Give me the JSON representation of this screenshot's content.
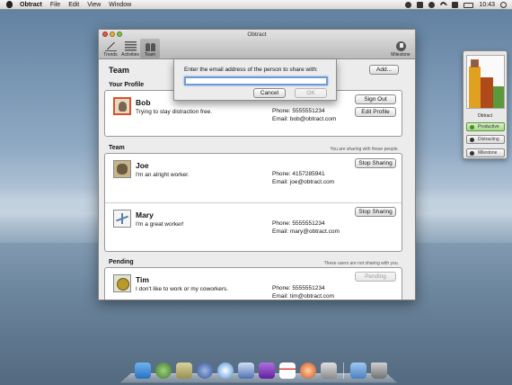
{
  "menubar": {
    "app_name": "Obtract",
    "menus": [
      "File",
      "Edit",
      "View",
      "Window"
    ],
    "clock": "10:43"
  },
  "window": {
    "title": "Obtract",
    "toolbar": {
      "trends": "Trends",
      "activities": "Activities",
      "team": "Team",
      "milestone": "Milestone"
    }
  },
  "team_page": {
    "title": "Team",
    "add_button": "Add...",
    "profile_section": "Your Profile",
    "team_section": "Team",
    "team_note": "You are sharing with these people.",
    "pending_section": "Pending",
    "pending_note": "These users are not sharing with you."
  },
  "profile": {
    "name": "Bob",
    "status": "Trying to stay distraction free.",
    "phone": "Phone: 5555551234",
    "email": "Email: bob@obtract.com",
    "sign_out": "Sign Out",
    "edit_profile": "Edit Profile"
  },
  "team_members": [
    {
      "name": "Joe",
      "status": "I'm an alright worker.",
      "phone": "Phone: 4157285941",
      "email": "Email: joe@obtract.com",
      "action": "Stop Sharing"
    },
    {
      "name": "Mary",
      "status": "I'm a great worker!",
      "phone": "Phone: 5555551234",
      "email": "Email: mary@obtract.com",
      "action": "Stop Sharing"
    }
  ],
  "pending": [
    {
      "name": "Tim",
      "status": "I don't like to work or my coworkers.",
      "phone": "Phone: 5555551234",
      "email": "Email: tim@obtract.com",
      "action": "Pending"
    }
  ],
  "sheet": {
    "prompt": "Enter the email address of the person to share with:",
    "input_value": "",
    "cancel": "Cancel",
    "ok": "OK"
  },
  "widget": {
    "title": "Obtract",
    "productive": "Productive",
    "distracting": "Distracting",
    "milestone": "Milestone",
    "colors": {
      "productive": "#5a9a3a",
      "distracting": "#b04a1a",
      "neutral": "#e0a020"
    }
  }
}
